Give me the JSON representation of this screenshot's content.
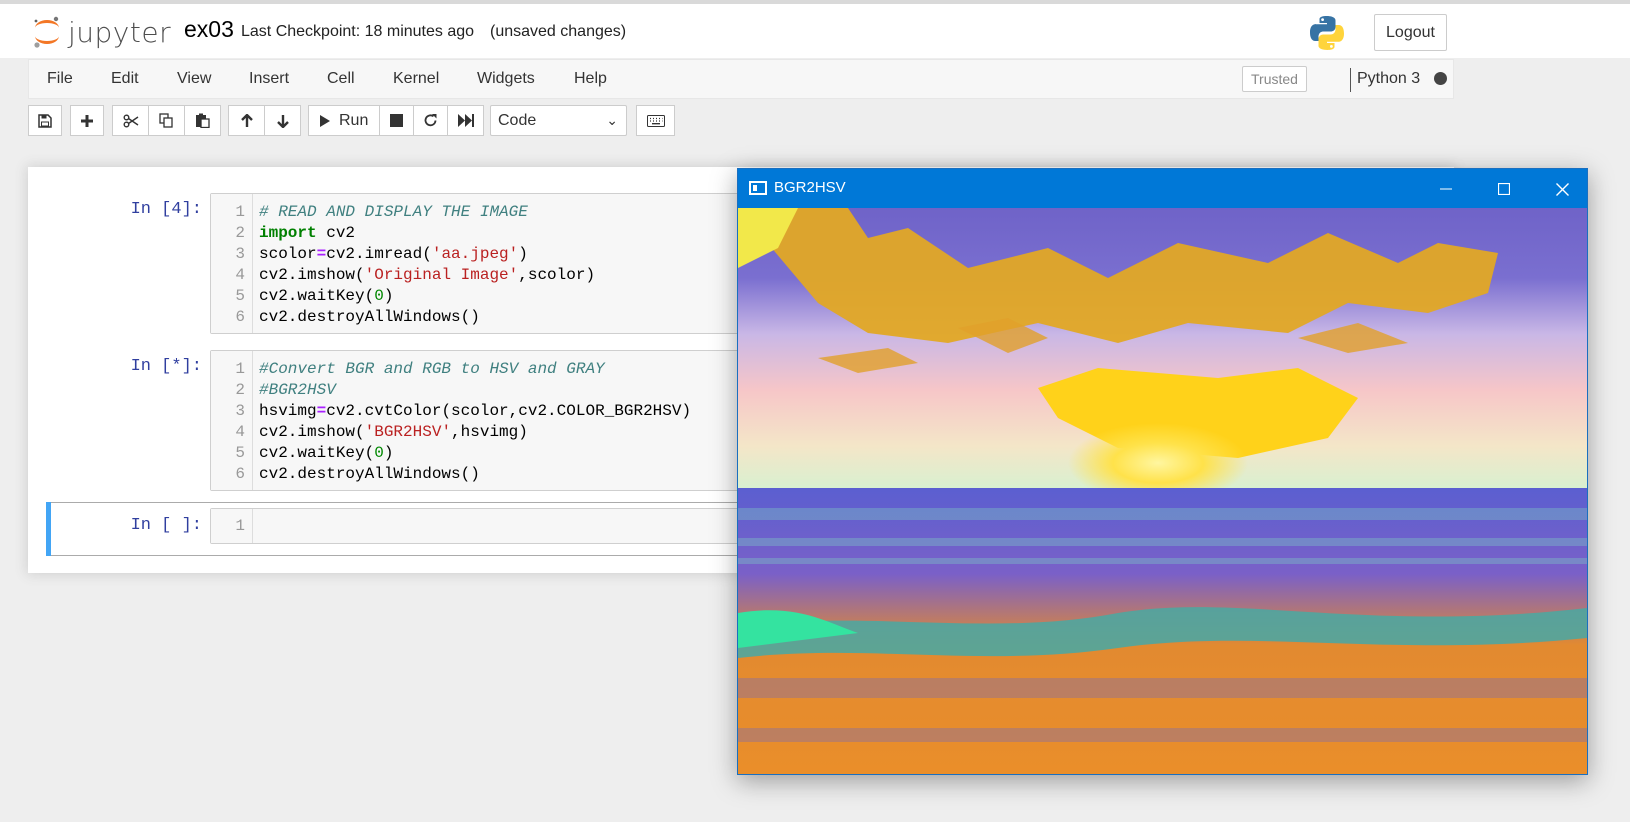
{
  "header": {
    "logo_text": "jupyter",
    "notebook_name": "ex03",
    "checkpoint": "Last Checkpoint: 18 minutes ago",
    "unsaved": "(unsaved changes)",
    "logout_label": "Logout"
  },
  "menu": [
    "File",
    "Edit",
    "View",
    "Insert",
    "Cell",
    "Kernel",
    "Widgets",
    "Help"
  ],
  "status": {
    "trusted": "Trusted",
    "kernel_name": "Python 3"
  },
  "toolbar": {
    "run_label": "Run",
    "cell_type": "Code"
  },
  "cells": [
    {
      "prompt": "In [4]:",
      "lines": [
        "# READ AND DISPLAY THE IMAGE",
        "import cv2",
        "scolor=cv2.imread('aa.jpeg')",
        "cv2.imshow('Original Image',scolor)",
        "cv2.waitKey(0)",
        "cv2.destroyAllWindows()"
      ]
    },
    {
      "prompt": "In [*]:",
      "lines": [
        "#Convert BGR and RGB to HSV and GRAY",
        "#BGR2HSV",
        "hsvimg=cv2.cvtColor(scolor,cv2.COLOR_BGR2HSV)",
        "cv2.imshow('BGR2HSV',hsvimg)",
        "cv2.waitKey(0)",
        "cv2.destroyAllWindows()"
      ]
    },
    {
      "prompt": "In [ ]:",
      "lines": [
        ""
      ]
    }
  ],
  "image_window": {
    "title": "BGR2HSV"
  },
  "colors": {
    "accent": "#0078d7",
    "prompt": "#303f9f",
    "selected_cell": "#42a5f5"
  }
}
